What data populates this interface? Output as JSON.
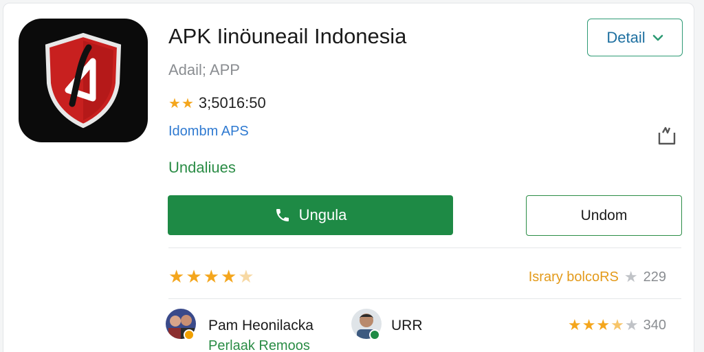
{
  "app": {
    "title": "APK Iinöuneail Indonesia",
    "subtitle": "Adail; APP",
    "rating_text": "3;5016:50",
    "rating_stars": 2,
    "developer_link": "Idombm APS",
    "status": "Undaliues"
  },
  "actions": {
    "detail_label": "Detail",
    "primary_label": "Ungula",
    "secondary_label": "Undom"
  },
  "reviews": {
    "summary_rating": 4.5,
    "summary_label": "Israry bolcoRS",
    "summary_count": "229",
    "reviewer1": {
      "name": "Pam Heonilacka",
      "subtitle": "Perlaak Remoos"
    },
    "reviewer2": {
      "name": "URR",
      "rating": 3.5,
      "count": "340"
    }
  },
  "colors": {
    "accent_green": "#1e8a45",
    "star": "#f4a61d",
    "link_blue": "#2f7ad1",
    "icon_red": "#c8201f"
  },
  "icons": {
    "app_icon": "red-shield-logo",
    "detail_chevron": "chevron-down-icon",
    "share": "share-icon",
    "primary": "phone-icon",
    "star": "star-icon"
  }
}
